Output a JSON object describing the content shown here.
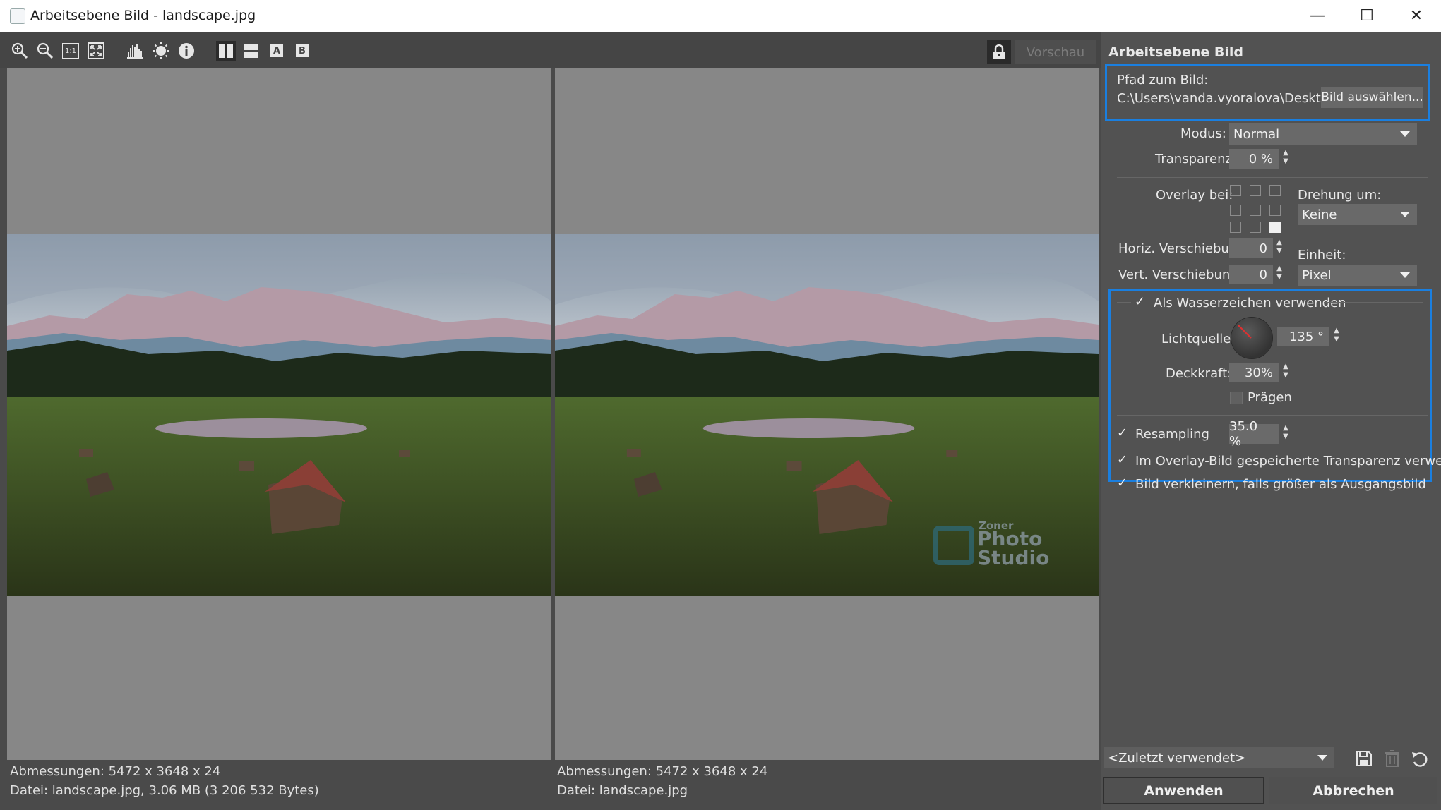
{
  "window": {
    "title": "Arbeitsebene Bild - landscape.jpg",
    "minimize": "—",
    "maximize": "☐",
    "close": "✕"
  },
  "toolbar": {
    "preview_label": "Vorschau",
    "btn_a": "A",
    "btn_b": "B",
    "zoom_1to1": "1:1"
  },
  "panes": {
    "left": {
      "dims": "Abmessungen: 5472 x 3648 x 24",
      "file": "Datei: landscape.jpg, 3.06 MB (3 206 532 Bytes)"
    },
    "right": {
      "dims": "Abmessungen: 5472 x 3648 x 24",
      "file": "Datei: landscape.jpg",
      "watermark_small": "Zoner",
      "watermark_line1": "Photo",
      "watermark_line2": "Studio"
    }
  },
  "side": {
    "heading": "Arbeitsebene Bild",
    "path_label": "Pfad zum Bild:",
    "path_value": "C:\\Users\\vanda.vyoralova\\Deskt...",
    "choose_button": "Bild auswählen...",
    "modus_label": "Modus:",
    "modus_value": "Normal",
    "transparenz_label": "Transparenz:",
    "transparenz_value": "0 %",
    "overlay_label": "Overlay bei:",
    "drehung_label": "Drehung um:",
    "drehung_value": "Keine",
    "horiz_label": "Horiz. Verschiebu...",
    "horiz_value": "0",
    "vert_label": "Vert. Verschiebun...",
    "vert_value": "0",
    "einheit_label": "Einheit:",
    "einheit_value": "Pixel",
    "watermark_label": "Als Wasserzeichen verwenden",
    "watermark_checked": true,
    "lichtquelle_label": "Lichtquelle:",
    "lichtquelle_value": "135 °",
    "deckkraft_label": "Deckkraft:",
    "deckkraft_value": "30%",
    "praegen_label": "Prägen",
    "praegen_checked": false,
    "resampling_label": "Resampling",
    "resampling_checked": true,
    "resampling_value": "35.0 %",
    "overlay_transparency_label": "Im Overlay-Bild gespeicherte Transparenz verwen...",
    "overlay_transparency_checked": true,
    "shrink_label": "Bild verkleinern, falls größer als Ausgangsbild",
    "shrink_checked": true,
    "preset_value": "<Zuletzt verwendet>",
    "apply_button": "Anwenden",
    "cancel_button": "Abbrechen"
  },
  "colors": {
    "accent_highlight": "#1a7fe0",
    "panel_bg": "#525252",
    "pane_bg": "#878787"
  }
}
